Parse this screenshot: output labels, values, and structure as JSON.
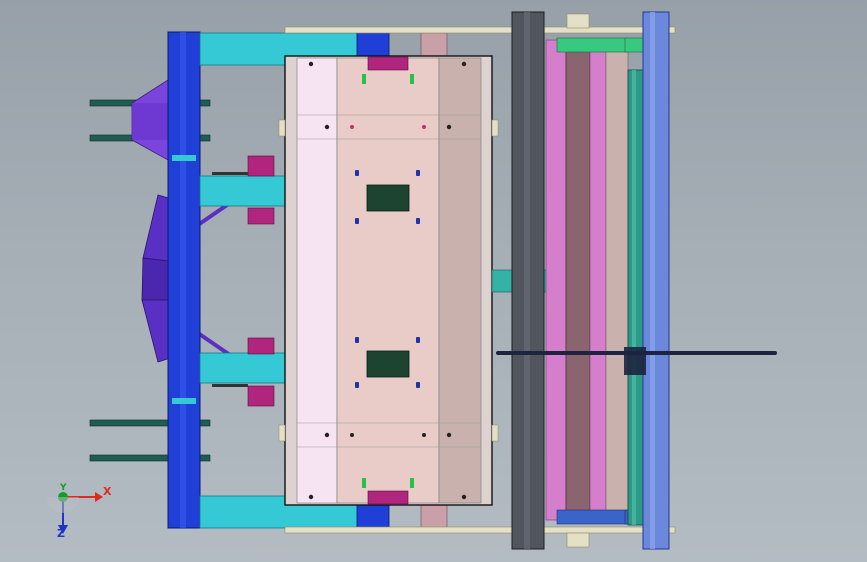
{
  "viewport": {
    "background_top": "#97a0a8",
    "background_bottom": "#b4bcc3"
  },
  "triad": {
    "x_label": "X",
    "y_label": "Y",
    "z_label": "Z",
    "x_color": "#e0281f",
    "y_color": "#149c2b",
    "z_color": "#2034c8"
  },
  "colors": {
    "frame_blue": "#1f3fd6",
    "beam_cyan": "#35c9d6",
    "plate_pink": "#e9ccc8",
    "plate_light": "#f6e4f2",
    "plate_mauve": "#c9b2ae",
    "bar_dark": "#51555e",
    "roller_pink": "#d57fcc",
    "roller_brown": "#8a646e",
    "roller_green": "#2d9a86",
    "roller_blue": "#6c88dc",
    "bracket_purple": "#5a2fc4",
    "clamp_magenta": "#b0257e",
    "rod_green": "#1f5d52",
    "window_green": "#1c4430",
    "rail_cream": "#e4e0c6"
  }
}
